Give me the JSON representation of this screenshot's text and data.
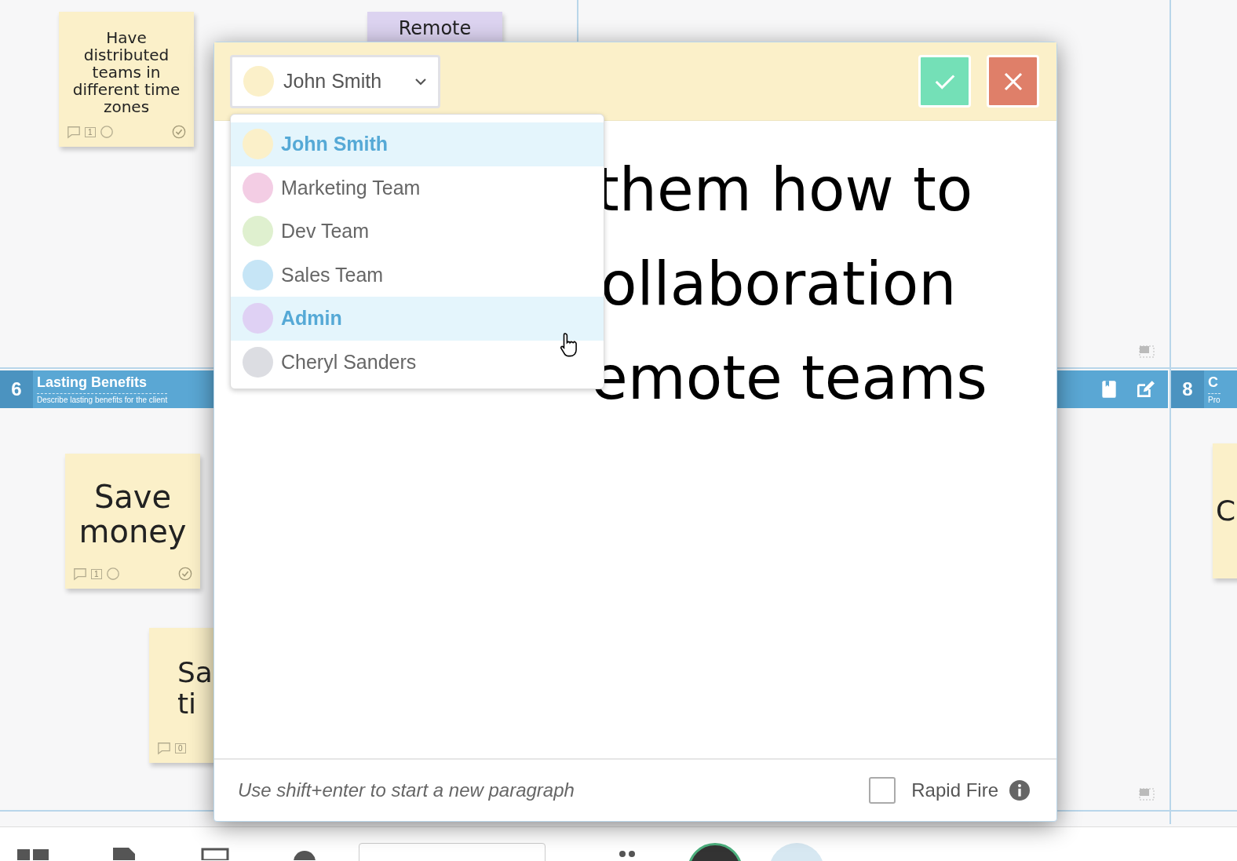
{
  "board": {
    "notes": [
      {
        "text": "Have distributed teams in different time zones",
        "color": "#fbf0c9",
        "count": "1",
        "done": true
      },
      {
        "text": "Remote",
        "color": "#dcd3f0"
      },
      {
        "text": "Save money",
        "color": "#fbf0c9",
        "count": "1",
        "done": true
      },
      {
        "text": "Sa\nti",
        "color": "#fbf0c9",
        "count": "0"
      },
      {
        "text": "C",
        "color": "#fbf0c9"
      }
    ],
    "sections": [
      {
        "number": "6",
        "title": "Lasting Benefits",
        "subtitle": "Describe lasting benefits for the client",
        "tools": true
      },
      {
        "number": "8",
        "title": "C",
        "subtitle": "Pro"
      }
    ]
  },
  "editor": {
    "owner": {
      "name": "John Smith",
      "color": "#fbf0c9"
    },
    "owners": [
      {
        "name": "John Smith",
        "color": "#fbf0c9",
        "highlighted": true
      },
      {
        "name": "Marketing Team",
        "color": "#f3cde4",
        "highlighted": false
      },
      {
        "name": "Dev Team",
        "color": "#dff0cf",
        "highlighted": false
      },
      {
        "name": "Sales Team",
        "color": "#c6e5f6",
        "highlighted": false
      },
      {
        "name": "Admin",
        "color": "#dfd1f4",
        "highlighted": true
      },
      {
        "name": "Cheryl Sanders",
        "color": "#dcdde2",
        "highlighted": false
      }
    ],
    "text_lines": [
      "them how to",
      "ollaboration",
      "emote teams"
    ],
    "hint": "Use shift+enter to start a new paragraph",
    "rapid_fire": {
      "label": "Rapid Fire",
      "checked": false
    }
  }
}
